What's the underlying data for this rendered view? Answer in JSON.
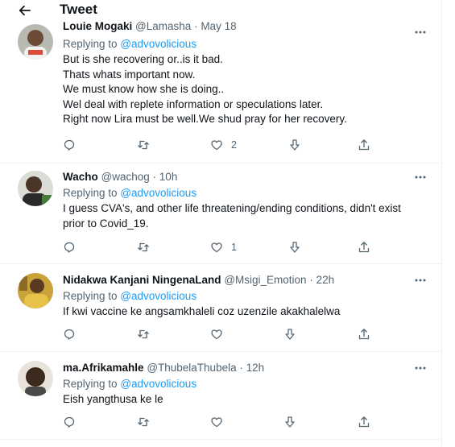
{
  "header": {
    "title": "Tweet"
  },
  "tweets": [
    {
      "name": "Louie Mogaki",
      "handle": "@Lamasha",
      "time": "May 18",
      "replying_label": "Replying to",
      "replying_to": "@advovolicious",
      "lines": [
        "But is she recovering or..is it bad.",
        "Thats whats important now.",
        "We must know how she is doing..",
        "Wel deal with replete information or speculations later.",
        "Right now Lira must be well.We shud pray for her recovery."
      ],
      "likes": "2"
    },
    {
      "name": "Wacho",
      "handle": "@wachog",
      "time": "10h",
      "replying_label": "Replying to",
      "replying_to": "@advovolicious",
      "lines": [
        "I guess CVA's, and other life threatening/ending conditions, didn't exist",
        "prior to Covid_19."
      ],
      "likes": "1"
    },
    {
      "name": "Nidakwa Kanjani NingenaLand",
      "handle": "@Msigi_Emotion",
      "time": "22h",
      "replying_label": "Replying to",
      "replying_to": "@advovolicious",
      "lines": [
        "If kwi vaccine ke angsamkhaleli coz uzenzile akakhalelwa"
      ],
      "likes": ""
    },
    {
      "name": "ma.Afrikamahle",
      "handle": "@ThubelaThubela",
      "time": "12h",
      "replying_label": "Replying to",
      "replying_to": "@advovolicious",
      "lines": [
        "Eish yangthusa ke le"
      ],
      "likes": ""
    }
  ]
}
